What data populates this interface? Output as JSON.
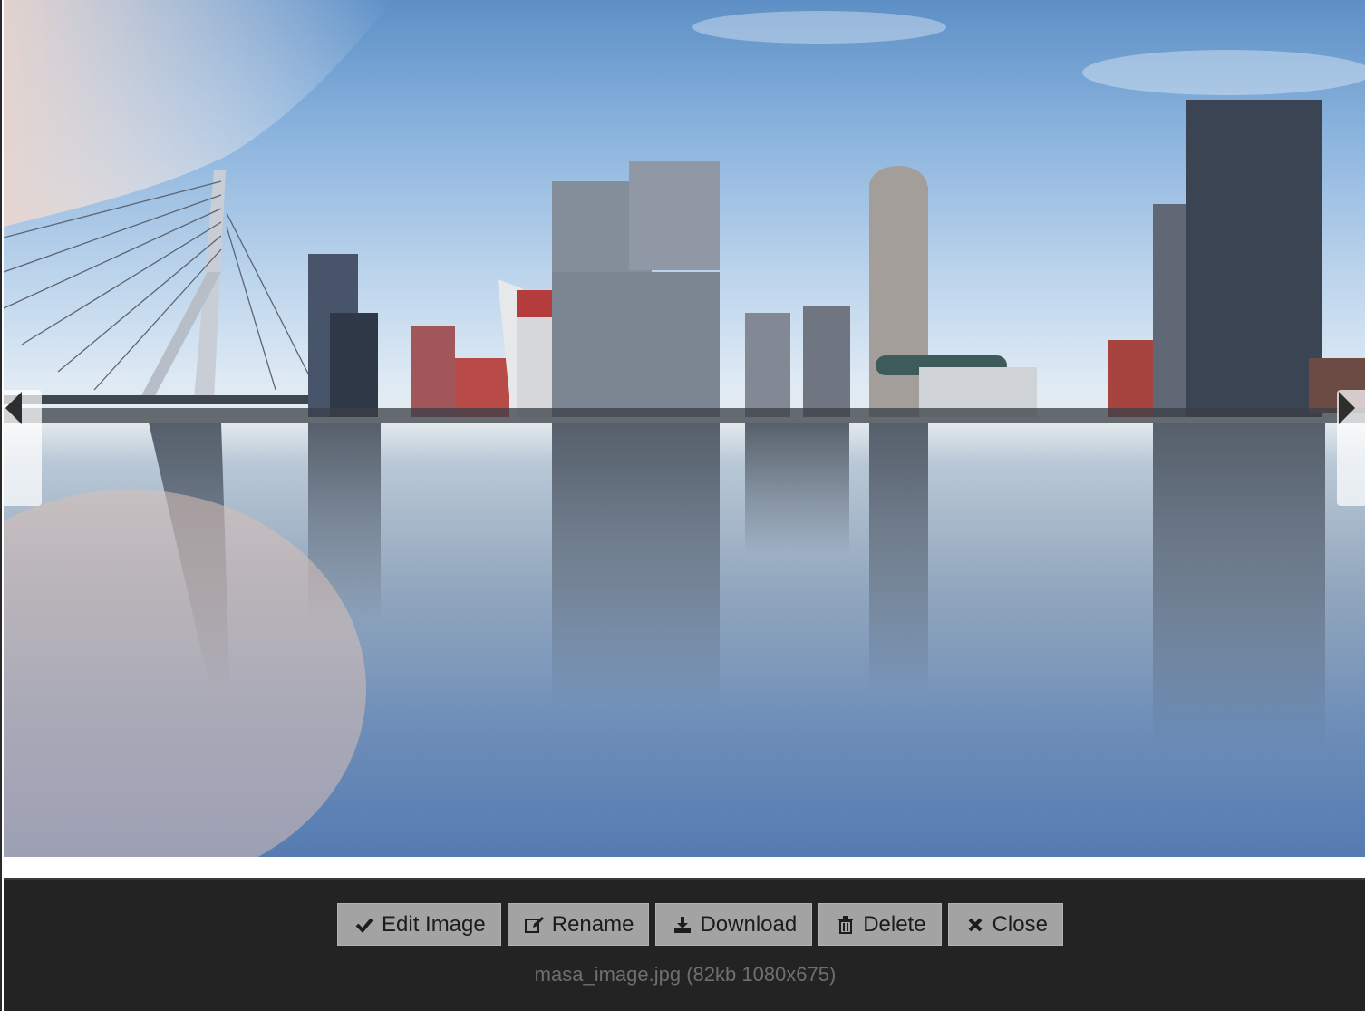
{
  "toolbar": {
    "buttons": [
      {
        "label": "Edit Image",
        "icon": "check-icon"
      },
      {
        "label": "Rename",
        "icon": "edit-icon"
      },
      {
        "label": "Download",
        "icon": "download-icon"
      },
      {
        "label": "Delete",
        "icon": "trash-icon"
      },
      {
        "label": "Close",
        "icon": "close-icon"
      }
    ],
    "file_info": "masa_image.jpg (82kb 1080x675)"
  },
  "navigation": {
    "prev_icon": "caret-left-icon",
    "next_icon": "caret-right-icon"
  },
  "colors": {
    "toolbar_bg": "#232323",
    "button_bg": "#a3a3a3",
    "info_text": "#6f6f6f"
  }
}
